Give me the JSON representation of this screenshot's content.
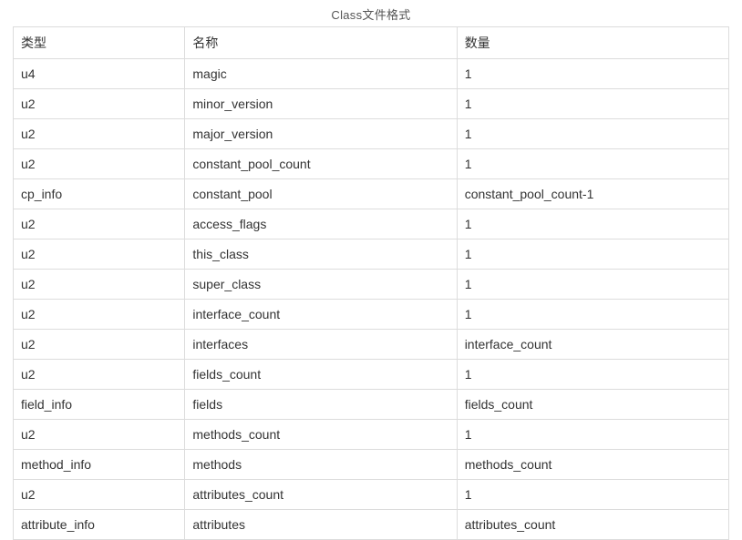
{
  "caption": "Class文件格式",
  "headers": {
    "type": "类型",
    "name": "名称",
    "quantity": "数量"
  },
  "rows": [
    {
      "type": "u4",
      "name": "magic",
      "quantity": "1"
    },
    {
      "type": "u2",
      "name": "minor_version",
      "quantity": "1"
    },
    {
      "type": "u2",
      "name": "major_version",
      "quantity": "1"
    },
    {
      "type": "u2",
      "name": "constant_pool_count",
      "quantity": "1"
    },
    {
      "type": "cp_info",
      "name": "constant_pool",
      "quantity": "constant_pool_count-1"
    },
    {
      "type": "u2",
      "name": "access_flags",
      "quantity": "1"
    },
    {
      "type": "u2",
      "name": "this_class",
      "quantity": "1"
    },
    {
      "type": "u2",
      "name": "super_class",
      "quantity": "1"
    },
    {
      "type": "u2",
      "name": "interface_count",
      "quantity": "1"
    },
    {
      "type": "u2",
      "name": "interfaces",
      "quantity": "interface_count"
    },
    {
      "type": "u2",
      "name": "fields_count",
      "quantity": "1"
    },
    {
      "type": "field_info",
      "name": "fields",
      "quantity": "fields_count"
    },
    {
      "type": "u2",
      "name": "methods_count",
      "quantity": "1"
    },
    {
      "type": "method_info",
      "name": "methods",
      "quantity": "methods_count"
    },
    {
      "type": "u2",
      "name": "attributes_count",
      "quantity": "1"
    },
    {
      "type": "attribute_info",
      "name": "attributes",
      "quantity": "attributes_count"
    }
  ]
}
